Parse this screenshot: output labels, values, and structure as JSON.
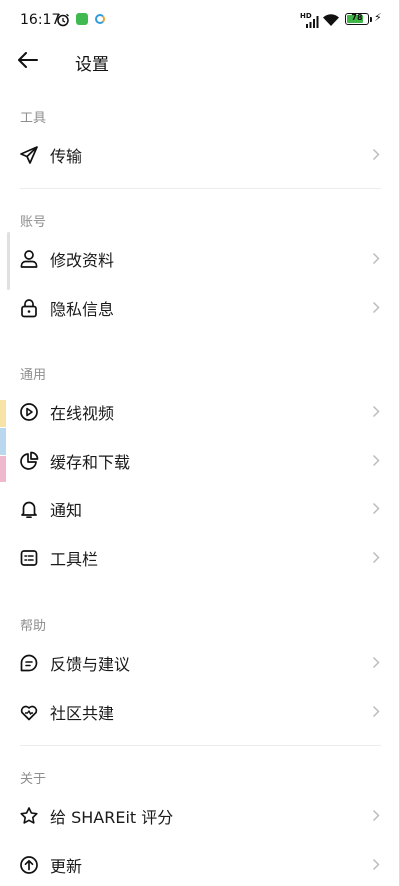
{
  "status_bar": {
    "time": "16:17",
    "network": "HD",
    "battery": "78",
    "icons": [
      "alarm-icon",
      "app-notification-icon",
      "sync-icon",
      "signal-icon",
      "wifi-icon",
      "battery-icon",
      "charging-icon"
    ]
  },
  "header": {
    "title": "设置",
    "back_icon": "arrow-left-icon"
  },
  "sections": {
    "tools": {
      "label": "工具",
      "items": [
        {
          "label": "传输",
          "icon": "send-icon"
        }
      ]
    },
    "account": {
      "label": "账号",
      "items": [
        {
          "label": "修改资料",
          "icon": "user-icon"
        },
        {
          "label": "隐私信息",
          "icon": "lock-icon"
        }
      ]
    },
    "general": {
      "label": "通用",
      "items": [
        {
          "label": "在线视频",
          "icon": "play-circle-icon"
        },
        {
          "label": "缓存和下载",
          "icon": "pie-chart-icon"
        },
        {
          "label": "通知",
          "icon": "bell-icon"
        },
        {
          "label": "工具栏",
          "icon": "toolbar-icon"
        }
      ]
    },
    "help": {
      "label": "帮助",
      "items": [
        {
          "label": "反馈与建议",
          "icon": "chat-icon"
        },
        {
          "label": "社区共建",
          "icon": "heart-icon"
        }
      ]
    },
    "about": {
      "label": "关于",
      "items": [
        {
          "label": "给 SHAREit 评分",
          "icon": "star-icon"
        },
        {
          "label": "更新",
          "icon": "arrow-up-circle-icon"
        }
      ]
    }
  },
  "colors": {
    "section_label": "#8e8e8e",
    "divider": "#ececec",
    "chevron": "#bdbdbd",
    "battery_fill": "#41b649",
    "edge_yellow": "#f7e3a6",
    "edge_blue": "#b9d8ee",
    "edge_pink": "#f0b8cf"
  }
}
